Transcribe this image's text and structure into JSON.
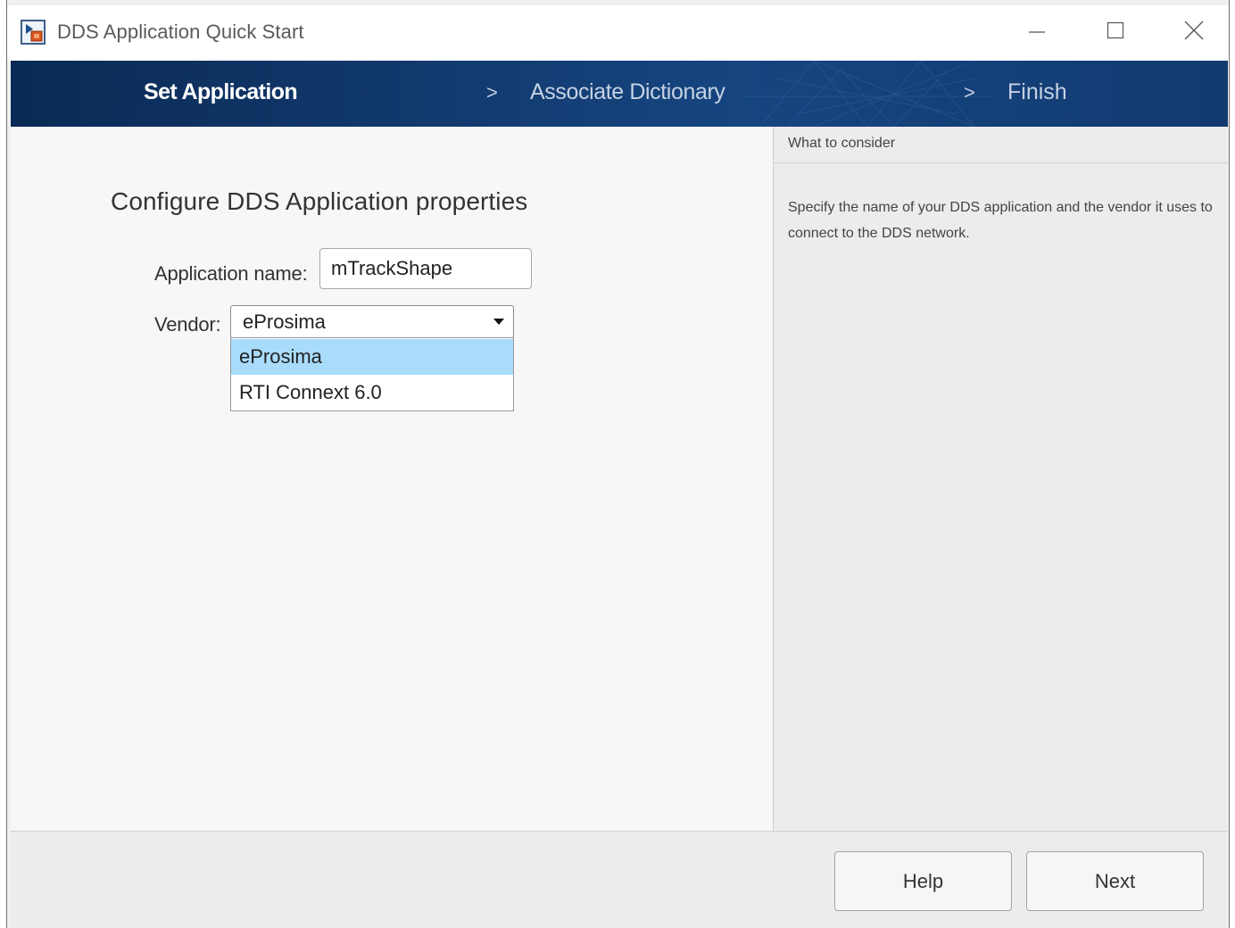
{
  "window": {
    "title": "DDS Application Quick Start",
    "app_icon": "simulink-app-icon",
    "controls": [
      "minimize-icon",
      "maximize-icon",
      "close-icon"
    ]
  },
  "wizard": {
    "steps": [
      {
        "label": "Set Application",
        "active": true
      },
      {
        "label": "Associate Dictionary",
        "active": false
      },
      {
        "label": "Finish",
        "active": false
      }
    ],
    "separator": ">"
  },
  "main": {
    "section_title": "Configure DDS Application properties",
    "application_name": {
      "label": "Application name:",
      "value": "mTrackShape"
    },
    "vendor": {
      "label": "Vendor:",
      "selected": "eProsima",
      "options": [
        "eProsima",
        "RTI Connext 6.0"
      ],
      "highlighted_option": 0
    }
  },
  "side_panel": {
    "header": "What to consider",
    "body": "Specify the name of your DDS application and the vendor it uses to connect to the DDS network."
  },
  "footer": {
    "help_label": "Help",
    "next_label": "Next"
  },
  "colors": {
    "header_bar": "#123a6e",
    "dropdown_highlight": "#a9dcfb",
    "window_background": "#f0f0f0"
  }
}
